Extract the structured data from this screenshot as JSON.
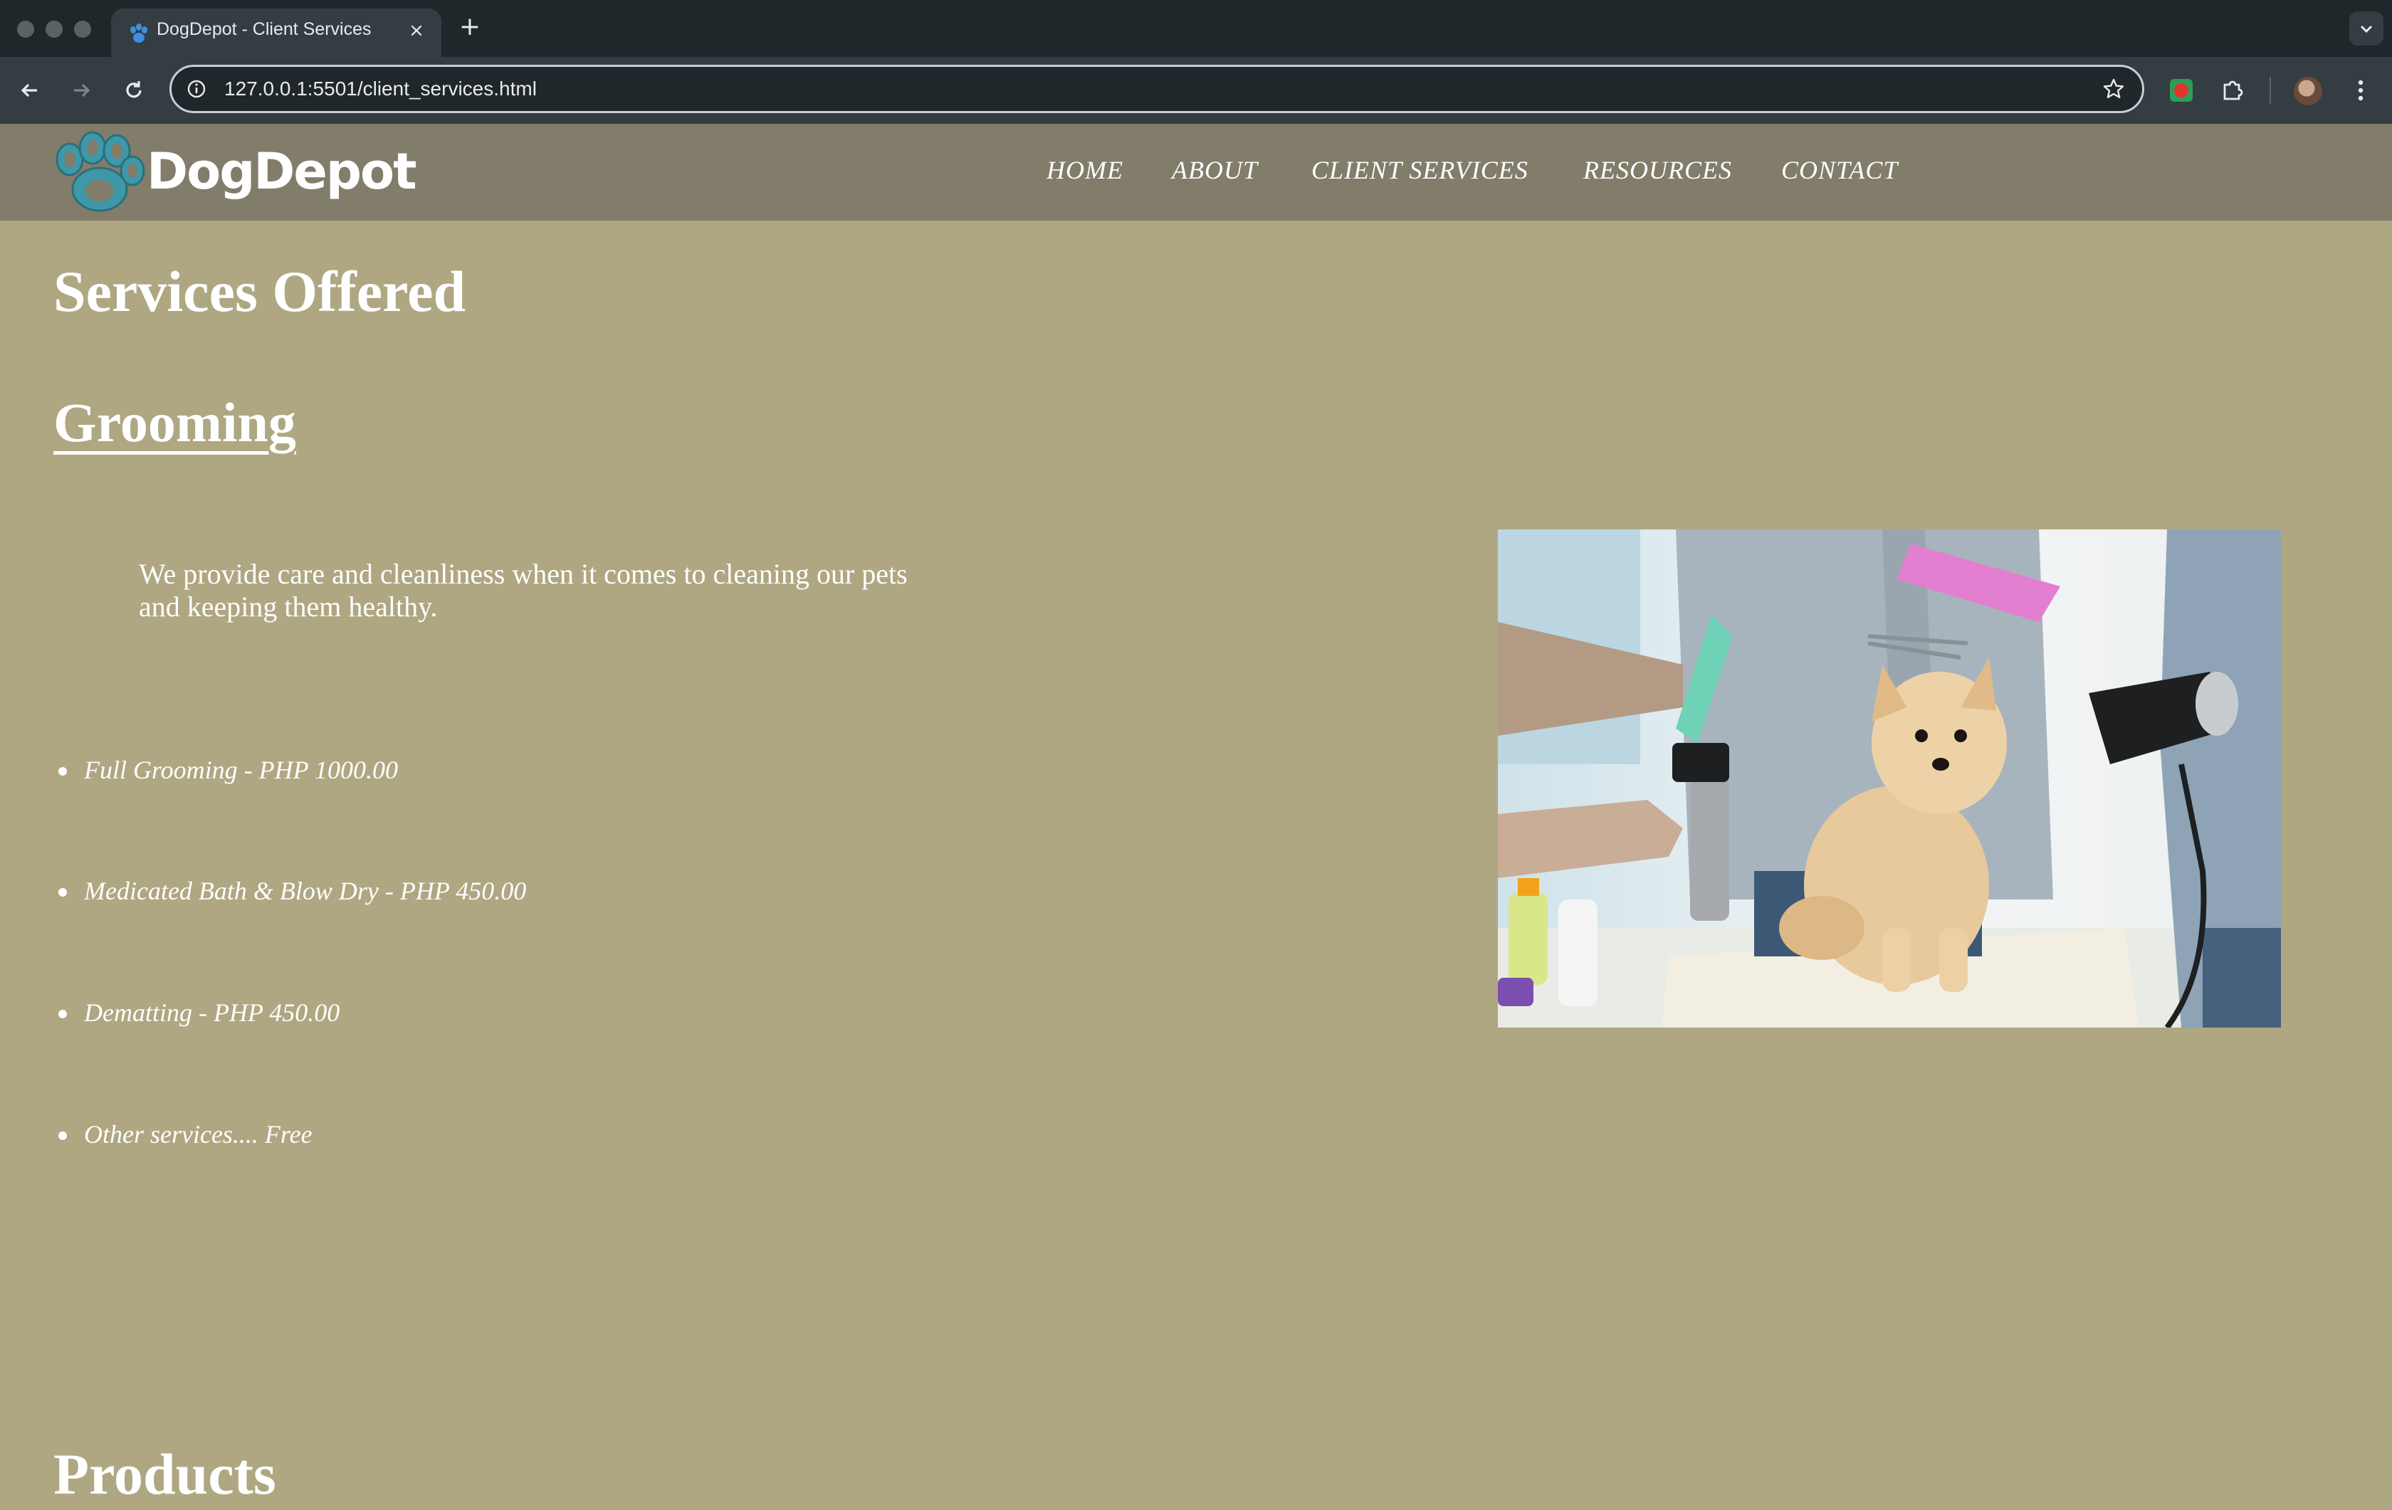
{
  "browser": {
    "tab_title": "DogDepot - Client Services",
    "close_glyph": "×",
    "new_tab_glyph": "+",
    "url": "127.0.0.1:5501/client_services.html",
    "icons": [
      "back-arrow-icon",
      "forward-arrow-icon",
      "reload-icon",
      "site-info-icon",
      "bookmark-star-icon",
      "extension-icon",
      "puzzle-icon",
      "profile-avatar",
      "more-menu-icon"
    ]
  },
  "site": {
    "logo_text": "DogDepot",
    "nav": [
      "HOME",
      "ABOUT",
      "CLIENT SERVICES",
      "RESOURCES",
      "CONTACT"
    ],
    "colors": {
      "header": "#827c6b",
      "background": "#aea782",
      "logo_paw": "#3f98a8"
    }
  },
  "main": {
    "title": "Services Offered",
    "grooming": {
      "heading": "Grooming",
      "description": "We provide care and cleanliness when it comes to cleaning our pets and keeping them healthy.",
      "services": [
        "Full Grooming - PHP 1000.00",
        "Medicated Bath & Blow Dry - PHP 450.00",
        "Dematting - PHP 450.00",
        "Other services.... Free"
      ]
    },
    "products_heading": "Products"
  }
}
